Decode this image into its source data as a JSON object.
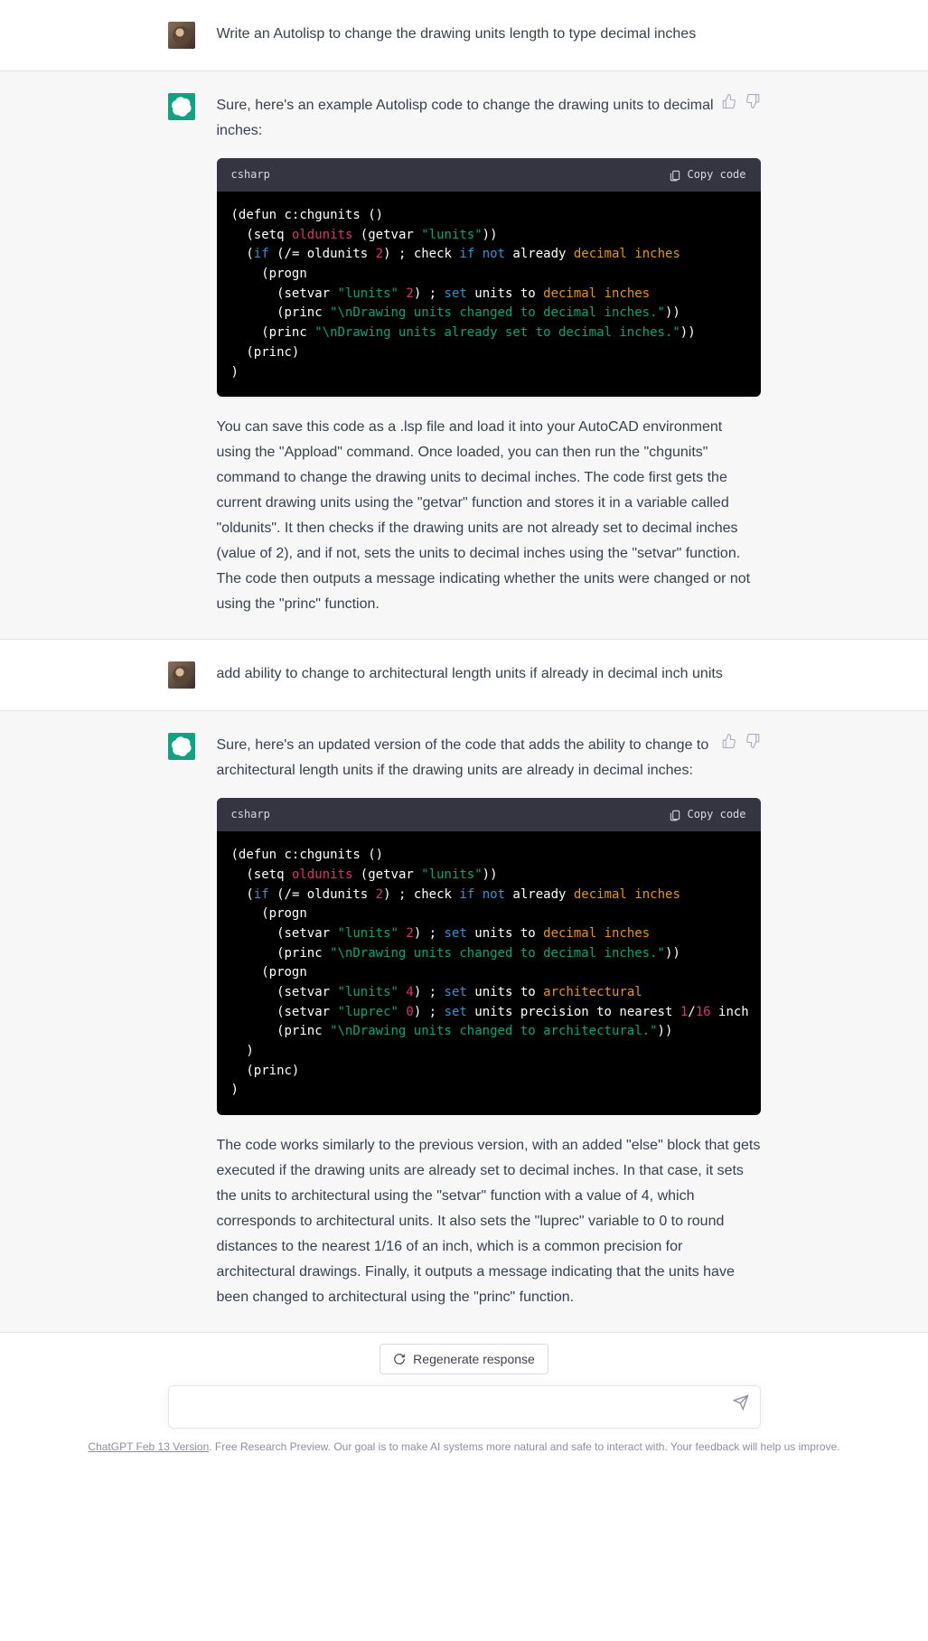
{
  "messages": {
    "user1": "Write an Autolisp to change the drawing units length to type decimal inches",
    "assistant1_intro": "Sure, here's an example Autolisp code to change the drawing units to decimal inches:",
    "assistant1_explain": "You can save this code as a .lsp file and load it into your AutoCAD environment using the \"Appload\" command. Once loaded, you can then run the \"chgunits\" command to change the drawing units to decimal inches. The code first gets the current drawing units using the \"getvar\" function and stores it in a variable called \"oldunits\". It then checks if the drawing units are not already set to decimal inches (value of 2), and if not, sets the units to decimal inches using the \"setvar\" function. The code then outputs a message indicating whether the units were changed or not using the \"princ\" function.",
    "user2": "add ability to change to architectural length units if already in decimal inch units",
    "assistant2_intro": "Sure, here's an updated version of the code that adds the ability to change to architectural length units if the drawing units are already in decimal inches:",
    "assistant2_explain": "The code works similarly to the previous version, with an added \"else\" block that gets executed if the drawing units are already set to decimal inches. In that case, it sets the units to architectural using the \"setvar\" function with a value of 4, which corresponds to architectural units. It also sets the \"luprec\" variable to 0 to round distances to the nearest 1/16 of an inch, which is a common precision for architectural drawings. Finally, it outputs a message indicating that the units have been changed to architectural using the \"princ\" function."
  },
  "code": {
    "lang": "csharp",
    "copy_label": "Copy code",
    "block1": {
      "l1a": "(defun c:chgunits ()",
      "l2a": "  (setq ",
      "l2b": "oldunits",
      "l2c": " (getvar ",
      "l2d": "\"lunits\"",
      "l2e": "))",
      "l3a": "  (",
      "l3b": "if",
      "l3c": " (/= oldunits ",
      "l3d": "2",
      "l3e": ") ; check ",
      "l3f": "if",
      "l3g": " ",
      "l3h": "not",
      "l3i": " already ",
      "l3j": "decimal",
      "l3k": " ",
      "l3l": "inches",
      "l4a": "    (progn",
      "l5a": "      (setvar ",
      "l5b": "\"lunits\"",
      "l5c": " ",
      "l5d": "2",
      "l5e": ") ; ",
      "l5f": "set",
      "l5g": " units to ",
      "l5h": "decimal",
      "l5i": " ",
      "l5j": "inches",
      "l6a": "      (princ ",
      "l6b": "\"\\nDrawing units changed to decimal inches.\"",
      "l6c": "))",
      "l7a": "    (princ ",
      "l7b": "\"\\nDrawing units already set to decimal inches.\"",
      "l7c": "))",
      "l8a": "  (princ)",
      "l9a": ")"
    },
    "block2": {
      "l1a": "(defun c:chgunits ()",
      "l2a": "  (setq ",
      "l2b": "oldunits",
      "l2c": " (getvar ",
      "l2d": "\"lunits\"",
      "l2e": "))",
      "l3a": "  (",
      "l3b": "if",
      "l3c": " (/= oldunits ",
      "l3d": "2",
      "l3e": ") ; check ",
      "l3f": "if",
      "l3g": " ",
      "l3h": "not",
      "l3i": " already ",
      "l3j": "decimal",
      "l3k": " ",
      "l3l": "inches",
      "l4a": "    (progn",
      "l5a": "      (setvar ",
      "l5b": "\"lunits\"",
      "l5c": " ",
      "l5d": "2",
      "l5e": ") ; ",
      "l5f": "set",
      "l5g": " units to ",
      "l5h": "decimal",
      "l5i": " ",
      "l5j": "inches",
      "l6a": "      (princ ",
      "l6b": "\"\\nDrawing units changed to decimal inches.\"",
      "l6c": "))",
      "l7a": "    (progn",
      "l8a": "      (setvar ",
      "l8b": "\"lunits\"",
      "l8c": " ",
      "l8d": "4",
      "l8e": ") ; ",
      "l8f": "set",
      "l8g": " units to ",
      "l8h": "architectural",
      "l9a": "      (setvar ",
      "l9b": "\"luprec\"",
      "l9c": " ",
      "l9d": "0",
      "l9e": ") ; ",
      "l9f": "set",
      "l9g": " units precision to nearest ",
      "l9h": "1",
      "l9i": "/",
      "l9j": "16",
      "l9k": " inch",
      "l10a": "      (princ ",
      "l10b": "\"\\nDrawing units changed to architectural.\"",
      "l10c": "))",
      "l11a": "  )",
      "l12a": "  (princ)",
      "l13a": ")"
    }
  },
  "footer": {
    "regenerate": "Regenerate response",
    "version_link": "ChatGPT Feb 13 Version",
    "disclaimer_rest": ". Free Research Preview. Our goal is to make AI systems more natural and safe to interact with. Your feedback will help us improve."
  }
}
